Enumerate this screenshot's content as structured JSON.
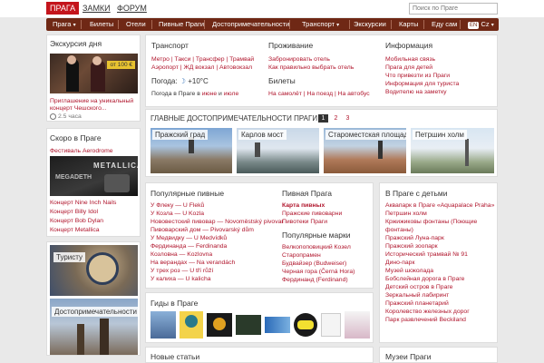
{
  "topbar": {
    "tabs": [
      {
        "label": "ПРАГА"
      },
      {
        "label": "ЗАМКИ"
      },
      {
        "label": "ФОРУМ"
      }
    ],
    "search_placeholder": "Поиск по Праге"
  },
  "nav": [
    {
      "label": "Прага"
    },
    {
      "label": "Билеты"
    },
    {
      "label": "Отели"
    },
    {
      "label": "Пивные Праги"
    },
    {
      "label": "Достопримечательности"
    },
    {
      "label": "Транспорт"
    },
    {
      "label": "Экскурсии"
    },
    {
      "label": "Карты"
    },
    {
      "label": "Еду сам"
    },
    {
      "label": "Cz",
      "badge": "EN"
    }
  ],
  "excursion": {
    "title": "Экскурсия дня",
    "price": "от 100 €",
    "text1": "Приглашение на уникальный",
    "text2": "концерт Чешского...",
    "duration": "2.5 часа"
  },
  "soon": {
    "title": "Скоро в Праге",
    "festival": "Фестиваль Aerodrome",
    "banner_top": "METALLICA",
    "banner_bottom": "MEGADETH",
    "concerts": [
      "Концерт Nine Inch Nails",
      "Концерт Billy Idol",
      "Концерт Bob Dylan",
      "Концерт Metallica"
    ]
  },
  "promo": {
    "tourists": "Туристу",
    "sights": "Достопримечательности"
  },
  "info": {
    "transport_title": "Транспорт",
    "transport_line1": "Метро | Такси | Трансфер | Трамвай",
    "transport_line2": "Аэропорт | ЖД вокзал | Автовокзал",
    "weather_label": "Погода:",
    "weather_value": "+10°C",
    "weather_month_prefix": "Погода в Праге в",
    "weather_month1": "июне",
    "weather_and": "и",
    "weather_month2": "июле",
    "living_title": "Проживание",
    "living_link1": "Забронировать отель",
    "living_link2": "Как правильно выбрать отель",
    "tickets_title": "Билеты",
    "tickets_line": "На самолёт | На поезд | На автобус",
    "information_title": "Информация",
    "information_links": [
      "Мобильная связь",
      "Прага для детей",
      "Что привезти из Праги",
      "Информация для туриста",
      "Водителю на заметку"
    ]
  },
  "sights": {
    "title": "ГЛАВНЫЕ ДОСТОПРИМЕЧАТЕЛЬНОСТИ ПРАГИ",
    "pages": [
      "1",
      "2",
      "3"
    ],
    "items": [
      {
        "caption": "Пражский град"
      },
      {
        "caption": "Карлов мост"
      },
      {
        "caption": "Староместская площадь"
      },
      {
        "caption": "Петршин холм"
      }
    ]
  },
  "beer": {
    "title": "Популярные пивные",
    "items": [
      "У Флеку — U Fleků",
      "У Козла — U Kozla",
      "Нововестский пивовар — Novoměstský pivovar",
      "Пивоварский дом — Pivovarský dům",
      "У Медвидку — U Medvídků",
      "Фердинанда — Ferdinanda",
      "Козловна — Kozlovna",
      "На верандах — Na verandách",
      "У трех роз — U tří růží",
      "У калиха — U kalicha"
    ],
    "beer_prague_title": "Пивная Прага",
    "beer_prague_links": [
      "Карта пивных",
      "Пражские пивоварни",
      "Пивотеки Праги"
    ],
    "brands_title": "Популярные марки",
    "brands": [
      "Велкопоповицкий Козел",
      "Старопрамен",
      "Будвайзер (Budweiser)",
      "Черная гора (Černá Hora)",
      "Фердинанд (Ferdinand)"
    ]
  },
  "kids": {
    "title": "В Праге с детьми",
    "items": [
      "Аквапарк в Праге «Aquapalace Praha»",
      "Петршин холм",
      "Кржижиковы фонтаны (Поющие фонтаны)",
      "Пражский Луна-парк",
      "Пражский зоопарк",
      "Исторический трамвай № 91",
      "Дино-парк",
      "Музей шоколада",
      "Бобслейная дорога в Праге",
      "Детский остров в Праге",
      "Зеркальный лабиринт",
      "Пражский планетарий",
      "Королевство железных дорог",
      "Парк развлечений Beckiland"
    ]
  },
  "guides": {
    "title": "Гиды в Праге"
  },
  "articles": {
    "title": "Новые статьи"
  },
  "museums": {
    "title": "Музеи Праги"
  },
  "colors": {
    "accent": "#c4151c",
    "nav": "#6f2815",
    "link": "#b0152c"
  }
}
